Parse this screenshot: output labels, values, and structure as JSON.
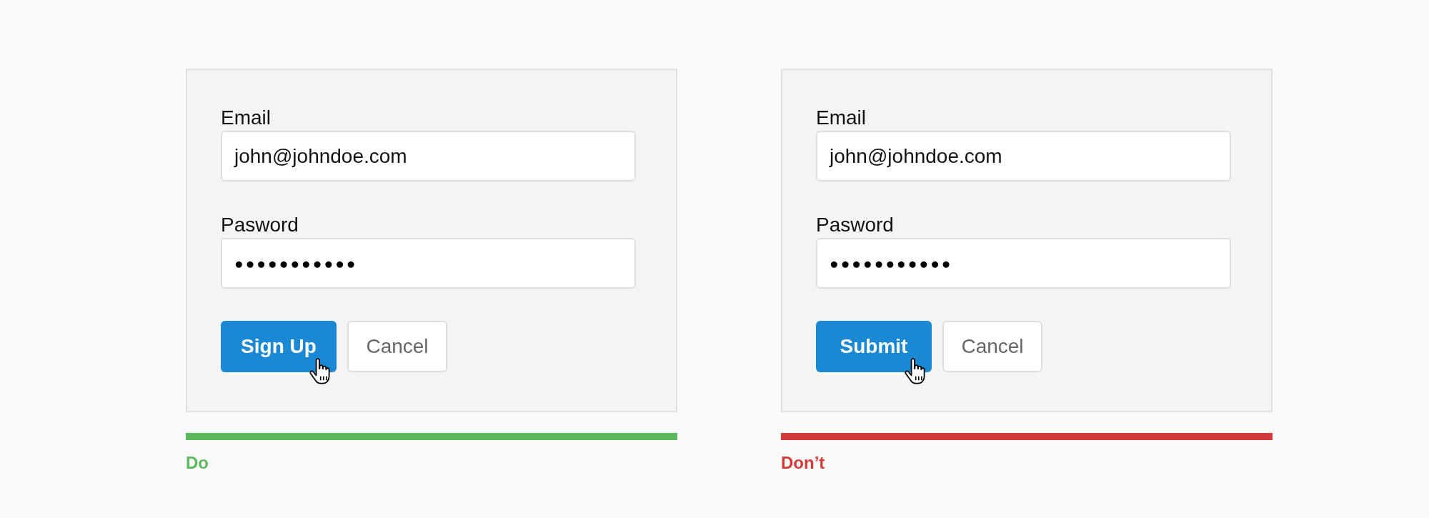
{
  "panels": [
    {
      "fields": [
        {
          "label": "Email",
          "kind": "text",
          "value": "john@johndoe.com"
        },
        {
          "label": "Pasword",
          "kind": "password",
          "value": "●●●●●●●●●●●"
        }
      ],
      "buttons": [
        {
          "label": "Sign Up",
          "kind": "primary",
          "hovered": true
        },
        {
          "label": "Cancel",
          "kind": "secondary",
          "hovered": false
        }
      ],
      "verdict": {
        "text": "Do",
        "color": "#5cb85c"
      }
    },
    {
      "fields": [
        {
          "label": "Email",
          "kind": "text",
          "value": "john@johndoe.com"
        },
        {
          "label": "Pasword",
          "kind": "password",
          "value": "●●●●●●●●●●●"
        }
      ],
      "buttons": [
        {
          "label": "Submit",
          "kind": "primary",
          "hovered": true
        },
        {
          "label": "Cancel",
          "kind": "secondary",
          "hovered": false
        }
      ],
      "verdict": {
        "text": "Don’t",
        "color": "#d33a3a"
      }
    }
  ]
}
